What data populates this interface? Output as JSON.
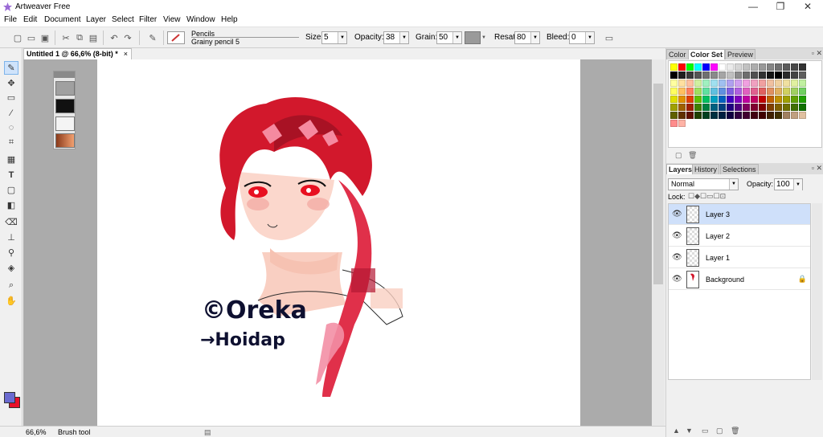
{
  "window": {
    "title": "Artweaver Free",
    "minimize_glyph": "—",
    "maximize_glyph": "❐",
    "close_glyph": "✕"
  },
  "menu": [
    "File",
    "Edit",
    "Document",
    "Layer",
    "Select",
    "Filter",
    "View",
    "Window",
    "Help"
  ],
  "toolbar": {
    "brush_category": "Pencils",
    "brush_variant": "Grainy pencil 5",
    "size_label": "Size:",
    "size_value": "5",
    "opacity_label": "Opacity:",
    "opacity_value": "38",
    "grain_label": "Grain:",
    "grain_value": "50",
    "resat_label": "Resat:",
    "resat_value": "80",
    "bleed_label": "Bleed:",
    "bleed_value": "0"
  },
  "document": {
    "tab_title": "Untitled 1 @ 66,6% (8-bit) *",
    "close_glyph": "×"
  },
  "color_panel": {
    "tabs": [
      "Color",
      "Color Set",
      "Preview"
    ],
    "active_tab": "Color Set",
    "swatches": [
      "#ffff00",
      "#ff0000",
      "#00ff00",
      "#00ffff",
      "#0000ff",
      "#ff00ff",
      "#ffffff",
      "#ebebeb",
      "#d6d6d6",
      "#c2c2c2",
      "#adadad",
      "#999999",
      "#858585",
      "#707070",
      "#5c5c5c",
      "#474747",
      "#333333",
      "#000000",
      "#1f1f1f",
      "#3a3a3a",
      "#555555",
      "#707070",
      "#8a8a8a",
      "#a5a5a5",
      "#c0c0c0",
      "#8c8c8c",
      "#6e6e6e",
      "#505050",
      "#323232",
      "#141414",
      "#000000",
      "#2a2a2a",
      "#444444",
      "#5e5e5e",
      "#ffffa0",
      "#ffe0a0",
      "#ffc0a0",
      "#d0f0a0",
      "#a0f0c0",
      "#a0e0f0",
      "#a0c0f0",
      "#b0a0f0",
      "#d0a0f0",
      "#f0a0e0",
      "#f0a0c0",
      "#f0a0a0",
      "#f0c0a0",
      "#f0d0a0",
      "#f0e0a0",
      "#e0f0a0",
      "#c0f0a0",
      "#ffff60",
      "#ffc060",
      "#ff8060",
      "#a0e060",
      "#60e0a0",
      "#60c0e0",
      "#6090e0",
      "#8060e0",
      "#b060e0",
      "#e060c0",
      "#e06090",
      "#e06060",
      "#e09060",
      "#e0b060",
      "#d0d060",
      "#a0d060",
      "#70d060",
      "#e0e000",
      "#e09000",
      "#e04000",
      "#60c000",
      "#00c060",
      "#00a0c0",
      "#0060c0",
      "#4000c0",
      "#8000c0",
      "#c000a0",
      "#c00060",
      "#c00000",
      "#c06000",
      "#c09000",
      "#a0a000",
      "#60a000",
      "#20a000",
      "#a0a000",
      "#a06000",
      "#a02000",
      "#408000",
      "#008040",
      "#006080",
      "#004080",
      "#200080",
      "#500080",
      "#800060",
      "#800030",
      "#800000",
      "#804000",
      "#806000",
      "#707000",
      "#407000",
      "#107000",
      "#606000",
      "#603000",
      "#601000",
      "#204000",
      "#004020",
      "#003040",
      "#002040",
      "#100040",
      "#300040",
      "#400030",
      "#400010",
      "#400000",
      "#402000",
      "#403000",
      "#a08060",
      "#c0a080",
      "#e0c0a0",
      "#ff8c8c",
      "#ffb3a6"
    ]
  },
  "layers_panel": {
    "tabs": [
      "Layers",
      "History",
      "Selections"
    ],
    "active_tab": "Layers",
    "blend_mode": "Normal",
    "opacity_label": "Opacity:",
    "opacity_value": "100",
    "lock_label": "Lock:",
    "layers": [
      {
        "name": "Layer 3",
        "selected": true
      },
      {
        "name": "Layer 2",
        "selected": false
      },
      {
        "name": "Layer 1",
        "selected": false
      },
      {
        "name": "Background",
        "selected": false,
        "locked": true
      }
    ]
  },
  "status": {
    "zoom": "66,6%",
    "tool": "Brush tool"
  },
  "canvas_text": {
    "line1": "©Oreka",
    "line2": "→Hoidap"
  },
  "colors": {
    "foreground": "#6a6ad0",
    "background": "#e8102a",
    "accent": "#cfe0fa"
  }
}
